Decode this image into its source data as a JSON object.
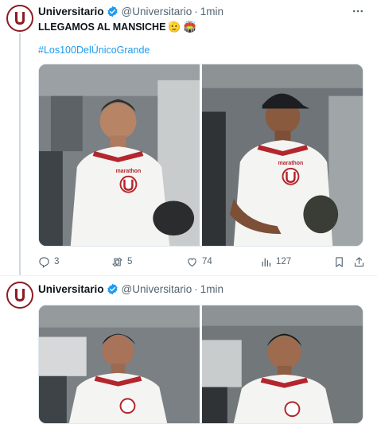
{
  "tweets": [
    {
      "display_name": "Universitario",
      "handle": "@Universitario",
      "separator": "·",
      "time": "1min",
      "text": "LLEGAMOS AL MANSICHE",
      "emoji_1": "🫡",
      "emoji_2": "🏟️",
      "hashtag": "#Los100DelÚnicoGrande",
      "shirt_text": "marathon",
      "stats": {
        "replies": "3",
        "retweets": "5",
        "likes": "74",
        "views": "127"
      }
    },
    {
      "display_name": "Universitario",
      "handle": "@Universitario",
      "separator": "·",
      "time": "1min"
    }
  ],
  "colors": {
    "brand": "#8c1c24",
    "verified": "#1d9bf0",
    "link": "#1d9bf0",
    "muted": "#536471",
    "thread_line": "#cfd9de"
  },
  "icons": [
    "club-crest-icon",
    "verified-badge-icon",
    "more-icon",
    "reply-icon",
    "retweet-icon",
    "like-icon",
    "views-icon",
    "bookmark-icon",
    "share-icon"
  ]
}
